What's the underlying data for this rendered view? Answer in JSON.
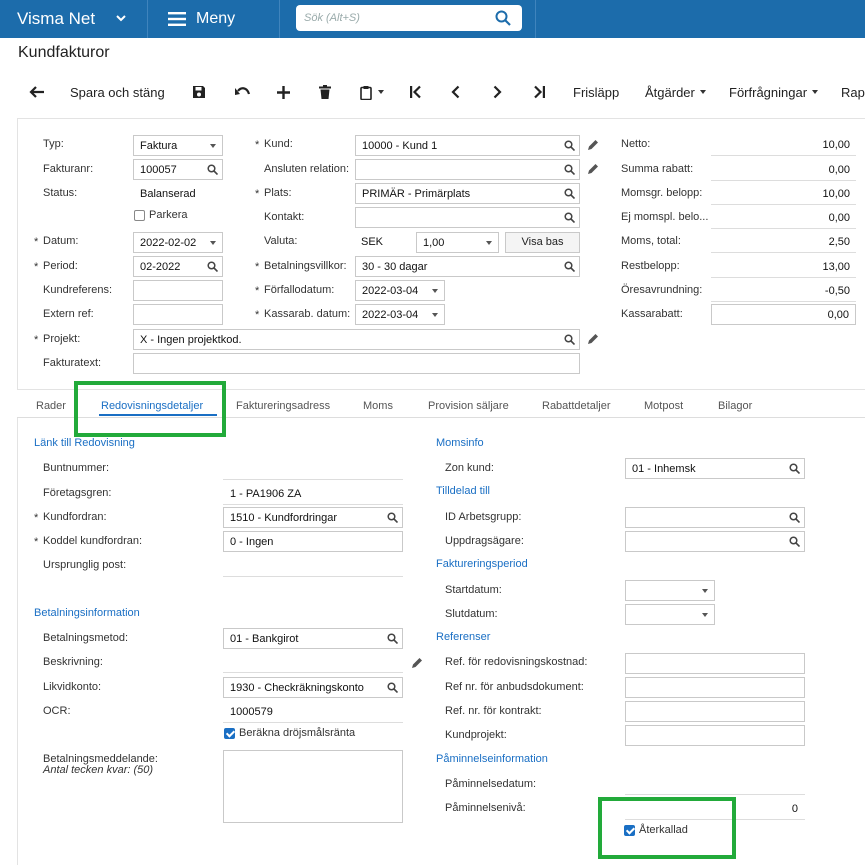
{
  "topbar": {
    "brand": "Visma Net",
    "menu_label": "Meny",
    "search_placeholder": "Sök (Alt+S)"
  },
  "page_title": "Kundfakturor",
  "toolbar": {
    "save_close": "Spara och stäng",
    "release": "Frisläpp",
    "actions": "Åtgärder",
    "inquiries": "Förfrågningar",
    "reports": "Rap"
  },
  "form": {
    "type_label": "Typ:",
    "type_value": "Faktura",
    "invoice_no_label": "Fakturanr:",
    "invoice_no_value": "100057",
    "status_label": "Status:",
    "status_value": "Balanserad",
    "hold_label": "Parkera",
    "date_label": "Datum:",
    "date_value": "2022-02-02",
    "period_label": "Period:",
    "period_value": "02-2022",
    "customer_ref_label": "Kundreferens:",
    "external_ref_label": "Extern ref:",
    "project_label": "Projekt:",
    "project_value": "X - Ingen projektkod.",
    "invoice_text_label": "Fakturatext:",
    "customer_label": "Kund:",
    "customer_value": "10000 - Kund 1",
    "related_label": "Ansluten relation:",
    "location_label": "Plats:",
    "location_value": "PRIMÄR - Primärplats",
    "contact_label": "Kontakt:",
    "currency_label": "Valuta:",
    "currency_value": "SEK",
    "rate_value": "1,00",
    "show_base_label": "Visa bas",
    "terms_label": "Betalningsvillkor:",
    "terms_value": "30 - 30 dagar",
    "due_date_label": "Förfallodatum:",
    "due_date_value": "2022-03-04",
    "cash_disc_date_label": "Kassarab. datum:",
    "cash_disc_date_value": "2022-03-04"
  },
  "totals": [
    {
      "label": "Netto:",
      "value": "10,00"
    },
    {
      "label": "Summa rabatt:",
      "value": "0,00"
    },
    {
      "label": "Momsgr. belopp:",
      "value": "10,00"
    },
    {
      "label": "Ej momspl. belo...",
      "value": "0,00"
    },
    {
      "label": "Moms, total:",
      "value": "2,50"
    },
    {
      "label": "Restbelopp:",
      "value": "13,00"
    },
    {
      "label": "Öresavrundning:",
      "value": "-0,50"
    },
    {
      "label": "Kassarabatt:",
      "value": "0,00"
    }
  ],
  "tabs": [
    "Rader",
    "Redovisningsdetaljer",
    "Faktureringsadress",
    "Moms",
    "Provision säljare",
    "Rabattdetaljer",
    "Motpost",
    "Bilagor"
  ],
  "details": {
    "link_section": "Länk till Redovisning",
    "batch_label": "Buntnummer:",
    "branch_label": "Företagsgren:",
    "branch_value": "1 - PA1906 ZA",
    "ar_account_label": "Kundfordran:",
    "ar_account_value": "1510 - Kundfordringar",
    "ar_sub_label": "Koddel kundfordran:",
    "ar_sub_value": "0 - Ingen",
    "orig_doc_label": "Ursprunglig post:",
    "payment_section": "Betalningsinformation",
    "pay_method_label": "Betalningsmetod:",
    "pay_method_value": "01 - Bankgirot",
    "description_label": "Beskrivning:",
    "cash_account_label": "Likvidkonto:",
    "cash_account_value": "1930 - Checkräkningskonto",
    "ocr_label": "OCR:",
    "ocr_value": "1000579",
    "late_interest_label": "Beräkna dröjsmålsränta",
    "payment_message_label": "Betalningsmeddelande:",
    "chars_left_label": "Antal tecken kvar: (50)",
    "vat_section": "Momsinfo",
    "zone_label": "Zon kund:",
    "zone_value": "01 - Inhemsk",
    "assigned_section": "Tilldelad till",
    "workgroup_label": "ID Arbetsgrupp:",
    "owner_label": "Uppdragsägare:",
    "billing_period_section": "Faktureringsperiod",
    "start_label": "Startdatum:",
    "end_label": "Slutdatum:",
    "refs_section": "Referenser",
    "ref_cost_label": "Ref. för redovisningskostnad:",
    "ref_quote_label": "Ref nr. för anbudsdokument:",
    "ref_contract_label": "Ref. nr. för kontrakt:",
    "cust_project_label": "Kundprojekt:",
    "reminder_section": "Påminnelseinformation",
    "reminder_date_label": "Påminnelsedatum:",
    "reminder_level_label": "Påminnelsenivå:",
    "reminder_level_value": "0",
    "recalled_label": "Återkallad"
  },
  "colors": {
    "topbar": "#1c6cab",
    "accent": "#1a6fc4",
    "highlight": "#22aa3a"
  }
}
